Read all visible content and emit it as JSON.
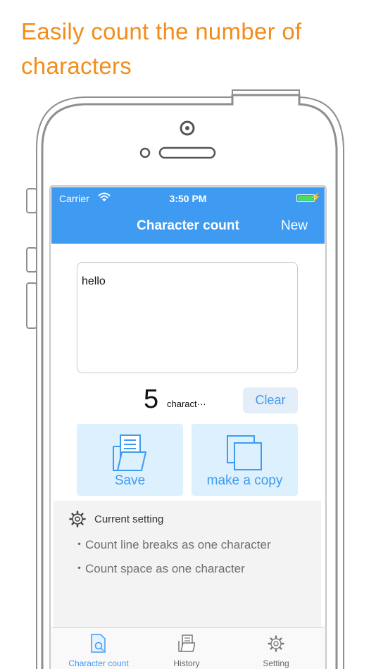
{
  "headline": "Easily count the number of characters",
  "status": {
    "carrier": "Carrier",
    "time": "3:50 PM"
  },
  "nav": {
    "title": "Character count",
    "new_label": "New"
  },
  "editor": {
    "text": "hello"
  },
  "counter": {
    "value": "5",
    "unit": "charact···",
    "clear_label": "Clear"
  },
  "actions": {
    "save_label": "Save",
    "copy_label": "make a copy"
  },
  "settings": {
    "title": "Current setting",
    "rules": [
      "・Count line breaks as one character",
      "・Count space as one character"
    ]
  },
  "tabs": [
    {
      "label": "Character count",
      "icon": "document-count-icon",
      "active": true
    },
    {
      "label": "History",
      "icon": "history-icon",
      "active": false
    },
    {
      "label": "Setting",
      "icon": "gear-icon",
      "active": false
    }
  ],
  "colors": {
    "accent": "#3f9bf2",
    "headline": "#f28c1a",
    "button_bg": "#dcf0fd",
    "battery": "#4cd964"
  }
}
